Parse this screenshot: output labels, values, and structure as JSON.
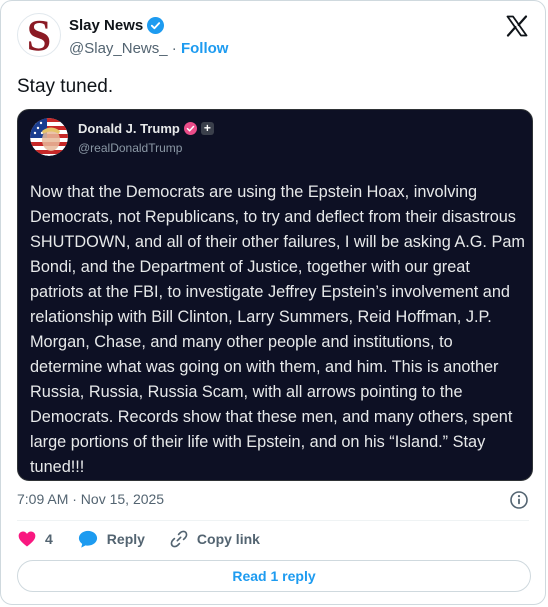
{
  "author": {
    "avatar_letter": "S",
    "name": "Slay News",
    "handle": "@Slay_News_",
    "separator": "·",
    "follow_label": "Follow"
  },
  "post": {
    "text": "Stay tuned."
  },
  "quoted": {
    "name": "Donald J. Trump",
    "handle": "@realDonaldTrump",
    "plus_label": "+",
    "text": "Now that the Democrats are using the Epstein Hoax, involving Democrats, not Republicans, to try and deflect from their disastrous SHUTDOWN, and all of their other failures, I will be asking A.G. Pam Bondi, and the Department of Justice, together with our great patriots at the FBI, to investigate Jeffrey Epstein’s involvement and relationship with Bill Clinton, Larry Summers, Reid Hoffman, J.P. Morgan, Chase, and many other people and institutions, to determine what was going on with them, and him. This is another Russia, Russia, Russia Scam, with all arrows pointing to the Democrats. Records show that these men, and many others, spent large portions of their life with Epstein, and on his “Island.” Stay tuned!!!"
  },
  "meta": {
    "timestamp": "7:09 AM · Nov 15, 2025"
  },
  "actions": {
    "like_count": "4",
    "reply_label": "Reply",
    "copy_link_label": "Copy link"
  },
  "footer": {
    "read_replies_label": "Read 1 reply"
  },
  "colors": {
    "accent": "#1d9bf0",
    "like": "#f91880",
    "quote_bg": "#0d1024",
    "brand": "#8b1a24"
  },
  "icons": [
    "x-logo-icon",
    "verified-badge-icon",
    "heart-icon",
    "reply-bubble-icon",
    "link-icon",
    "info-icon"
  ]
}
